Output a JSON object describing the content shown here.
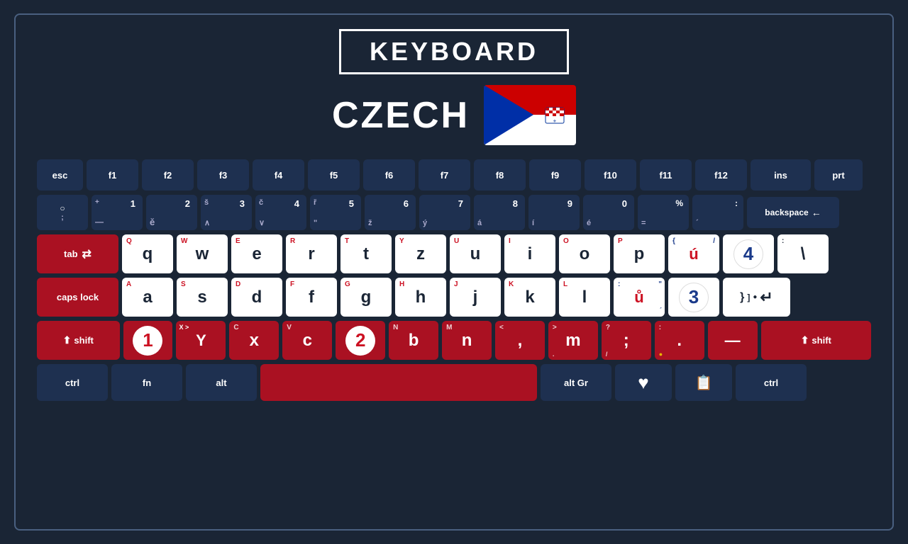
{
  "title": "KEYBOARD",
  "language": "CZECH",
  "flag": {
    "description": "Croatian flag with tricolor and coat of arms"
  },
  "keyboard": {
    "rows": [
      {
        "id": "function-row",
        "keys": [
          {
            "id": "esc",
            "label": "esc",
            "type": "dark",
            "width": "esc"
          },
          {
            "id": "f1",
            "label": "f1",
            "type": "dark",
            "width": "f"
          },
          {
            "id": "f2",
            "label": "f2",
            "type": "dark",
            "width": "f"
          },
          {
            "id": "f3",
            "label": "f3",
            "type": "dark",
            "width": "f"
          },
          {
            "id": "f4",
            "label": "f4",
            "type": "dark",
            "width": "f"
          },
          {
            "id": "f5",
            "label": "f5",
            "type": "dark",
            "width": "f"
          },
          {
            "id": "f6",
            "label": "f6",
            "type": "dark",
            "width": "f"
          },
          {
            "id": "f7",
            "label": "f7",
            "type": "dark",
            "width": "f"
          },
          {
            "id": "f8",
            "label": "f8",
            "type": "dark",
            "width": "f"
          },
          {
            "id": "f9",
            "label": "f9",
            "type": "dark",
            "width": "f"
          },
          {
            "id": "f10",
            "label": "f10",
            "type": "dark",
            "width": "f"
          },
          {
            "id": "f11",
            "label": "f11",
            "type": "dark",
            "width": "f"
          },
          {
            "id": "f12",
            "label": "f12",
            "type": "dark",
            "width": "f"
          },
          {
            "id": "ins",
            "label": "ins",
            "type": "dark",
            "width": "ins"
          },
          {
            "id": "prt",
            "label": "prt",
            "type": "dark",
            "width": "prt"
          }
        ]
      },
      {
        "id": "number-row",
        "keys": [
          {
            "id": "tilde",
            "top": "○",
            "bottom": ";",
            "type": "num",
            "width": "num"
          },
          {
            "id": "1",
            "top": "1",
            "bottom": "+",
            "sub": "—",
            "char": "",
            "type": "num",
            "width": "num"
          },
          {
            "id": "2",
            "top": "2",
            "bottom": "",
            "sub": "ě",
            "char": "",
            "type": "num",
            "width": "num"
          },
          {
            "id": "3",
            "top": "3",
            "bottom": "š",
            "sub": "∧",
            "type": "num",
            "width": "num"
          },
          {
            "id": "4",
            "top": "4",
            "bottom": "č",
            "sub": "∨",
            "type": "num",
            "width": "num"
          },
          {
            "id": "5",
            "top": "5",
            "bottom": "ř",
            "sub": "\"",
            "type": "num",
            "width": "num"
          },
          {
            "id": "6",
            "top": "6",
            "bottom": "ž",
            "sub": "",
            "type": "num",
            "width": "num"
          },
          {
            "id": "7",
            "top": "7",
            "bottom": "ý",
            "sub": "",
            "type": "num",
            "width": "num"
          },
          {
            "id": "8",
            "top": "8",
            "bottom": "á",
            "sub": "",
            "type": "num",
            "width": "num"
          },
          {
            "id": "9",
            "top": "9",
            "bottom": "í",
            "sub": "",
            "type": "num",
            "width": "num"
          },
          {
            "id": "0",
            "top": "0",
            "bottom": "é",
            "sub": "",
            "type": "num",
            "width": "num"
          },
          {
            "id": "percent",
            "top": "%",
            "bottom": "",
            "sub": "=",
            "type": "num",
            "width": "num"
          },
          {
            "id": "colon",
            "top": ":",
            "bottom": "",
            "sub": "´",
            "type": "num",
            "width": "num"
          },
          {
            "id": "backspace",
            "label": "backspace ←",
            "type": "dark",
            "width": "backspace"
          }
        ]
      },
      {
        "id": "qwerty-row",
        "keys": [
          {
            "id": "tab",
            "label": "tab",
            "symbol": "⇄",
            "type": "red-special",
            "width": "tab"
          },
          {
            "id": "q",
            "upper": "Q",
            "lower": "q",
            "type": "white",
            "width": "standard"
          },
          {
            "id": "w",
            "upper": "W",
            "lower": "w",
            "type": "white",
            "width": "standard"
          },
          {
            "id": "e",
            "upper": "E",
            "lower": "e",
            "type": "white",
            "width": "standard"
          },
          {
            "id": "r",
            "upper": "R",
            "lower": "r",
            "type": "white",
            "width": "standard"
          },
          {
            "id": "t",
            "upper": "T",
            "lower": "t",
            "type": "white",
            "width": "standard"
          },
          {
            "id": "y",
            "upper": "Y",
            "lower": "z",
            "type": "white",
            "width": "standard"
          },
          {
            "id": "u",
            "upper": "U",
            "lower": "u",
            "type": "white",
            "width": "standard"
          },
          {
            "id": "i",
            "upper": "I",
            "lower": "i",
            "type": "white",
            "width": "standard"
          },
          {
            "id": "o",
            "upper": "O",
            "lower": "o",
            "type": "white",
            "width": "standard"
          },
          {
            "id": "p",
            "upper": "P",
            "lower": "p",
            "type": "white",
            "width": "standard"
          },
          {
            "id": "bracket-l",
            "upper": "{",
            "lower": "ú",
            "type": "white-special4",
            "width": "standard"
          },
          {
            "id": "bracket-r",
            "upper": "4",
            "lower": "",
            "type": "white-num4",
            "width": "standard"
          },
          {
            "id": "backslash",
            "upper": ":",
            "lower": "\\",
            "type": "white",
            "width": "standard"
          }
        ]
      },
      {
        "id": "asdf-row",
        "keys": [
          {
            "id": "caps",
            "label": "caps lock",
            "type": "red-special",
            "width": "caps"
          },
          {
            "id": "a",
            "upper": "A",
            "lower": "a",
            "type": "white",
            "width": "standard"
          },
          {
            "id": "s",
            "upper": "S",
            "lower": "s",
            "type": "white",
            "width": "standard"
          },
          {
            "id": "d",
            "upper": "D",
            "lower": "d",
            "type": "white",
            "width": "standard"
          },
          {
            "id": "f",
            "upper": "F",
            "lower": "f",
            "type": "white",
            "width": "standard"
          },
          {
            "id": "g",
            "upper": "G",
            "lower": "g",
            "type": "white",
            "width": "standard"
          },
          {
            "id": "h",
            "upper": "H",
            "lower": "h",
            "type": "white",
            "width": "standard"
          },
          {
            "id": "j",
            "upper": "J",
            "lower": "j",
            "type": "white",
            "width": "standard"
          },
          {
            "id": "k",
            "upper": "K",
            "lower": "k",
            "type": "white",
            "width": "standard"
          },
          {
            "id": "l",
            "upper": "L",
            "lower": "l",
            "type": "white",
            "width": "standard"
          },
          {
            "id": "semicolon",
            "upper": ":",
            "lower": "ů",
            "sub": "\"",
            "type": "white-special3",
            "width": "standard"
          },
          {
            "id": "quote",
            "upper": "3",
            "lower": "",
            "type": "white-num3",
            "width": "standard"
          },
          {
            "id": "enter",
            "label": "↵",
            "type": "white",
            "width": "enter"
          }
        ]
      },
      {
        "id": "zxcv-row",
        "keys": [
          {
            "id": "shift-l",
            "label": "⬆ shift",
            "type": "red",
            "width": "shift-l"
          },
          {
            "id": "z-1",
            "upper": "",
            "lower": "1",
            "circle": true,
            "circleColor": "red",
            "type": "red-circle1",
            "width": "standard"
          },
          {
            "id": "y2",
            "upper": "X >",
            "lower": "Y",
            "type": "red-special2",
            "width": "standard"
          },
          {
            "id": "x",
            "upper": "C",
            "lower": "x",
            "type": "red",
            "width": "standard"
          },
          {
            "id": "c",
            "upper": "V",
            "lower": "c",
            "type": "red",
            "width": "standard"
          },
          {
            "id": "b-2",
            "upper": "",
            "lower": "2",
            "circle": true,
            "circleColor": "red",
            "type": "red-circle2",
            "width": "standard"
          },
          {
            "id": "n",
            "upper": "N",
            "lower": "b",
            "type": "red",
            "width": "standard"
          },
          {
            "id": "m",
            "upper": "M",
            "lower": "n",
            "type": "red",
            "width": "standard"
          },
          {
            "id": "comma",
            "upper": "<",
            "lower": ",",
            "type": "red",
            "width": "standard"
          },
          {
            "id": "period",
            "upper": ">",
            "lower": "m",
            "type": "red",
            "width": "standard"
          },
          {
            "id": "question",
            "upper": "?",
            "lower": ";",
            "sub": "/",
            "type": "red",
            "width": "standard"
          },
          {
            "id": "colon2",
            "upper": ":",
            "lower": ".",
            "sub": "●",
            "type": "red",
            "width": "standard"
          },
          {
            "id": "minus",
            "upper": "—",
            "lower": "—",
            "type": "red",
            "width": "standard"
          },
          {
            "id": "shift-r",
            "label": "⬆ shift",
            "type": "red",
            "width": "shift-r"
          }
        ]
      },
      {
        "id": "bottom-row",
        "keys": [
          {
            "id": "ctrl-l",
            "label": "ctrl",
            "type": "dark",
            "width": "ctrl"
          },
          {
            "id": "fn",
            "label": "fn",
            "type": "dark",
            "width": "fn"
          },
          {
            "id": "alt",
            "label": "alt",
            "type": "dark",
            "width": "alt"
          },
          {
            "id": "space",
            "label": "",
            "type": "red",
            "width": "space"
          },
          {
            "id": "altgr",
            "label": "alt Gr",
            "type": "dark",
            "width": "altgr"
          },
          {
            "id": "heart",
            "label": "♥",
            "type": "dark",
            "width": "heart"
          },
          {
            "id": "menu",
            "label": "≡",
            "type": "dark",
            "width": "menu"
          },
          {
            "id": "ctrl-r",
            "label": "ctrl",
            "type": "dark",
            "width": "ctrl"
          }
        ]
      }
    ]
  }
}
